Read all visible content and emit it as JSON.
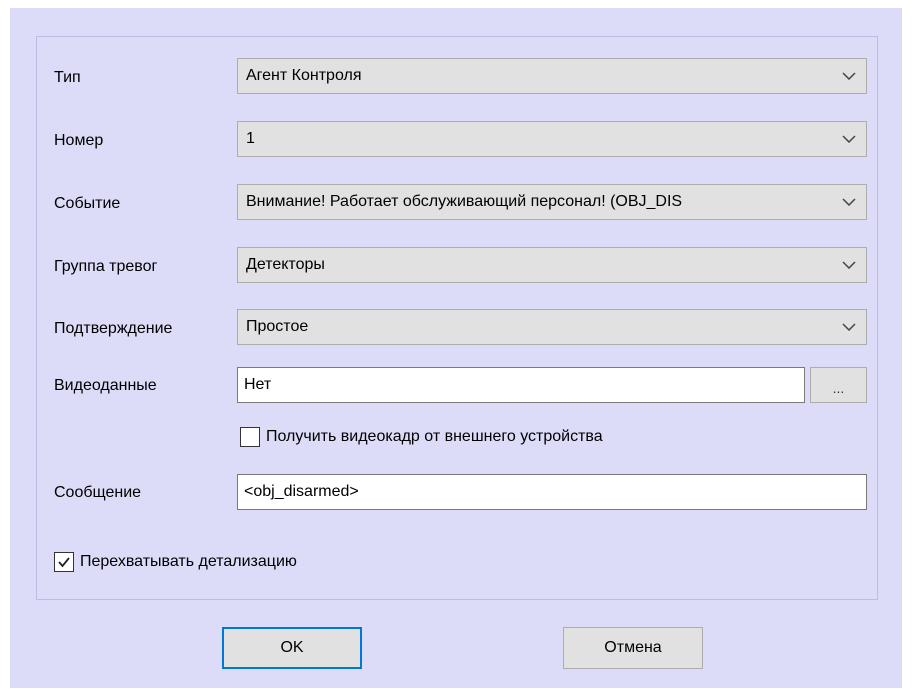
{
  "form": {
    "type_label": "Тип",
    "type_value": "Агент Контроля",
    "number_label": "Номер",
    "number_value": "1",
    "event_label": "Событие",
    "event_value": "Внимание! Работает обслуживающий персонал! (OBJ_DIS",
    "alarm_group_label": "Группа тревог",
    "alarm_group_value": "Детекторы",
    "confirmation_label": "Подтверждение",
    "confirmation_value": "Простое",
    "video_label": "Видеоданные",
    "video_value": "Нет",
    "browse_label": "...",
    "get_frame_label": "Получить видеокадр от внешнего устройства",
    "get_frame_checked": false,
    "message_label": "Сообщение",
    "message_value": "<obj_disarmed>",
    "intercept_label": "Перехватывать детализацию",
    "intercept_checked": true
  },
  "buttons": {
    "ok": "OK",
    "cancel": "Отмена"
  }
}
